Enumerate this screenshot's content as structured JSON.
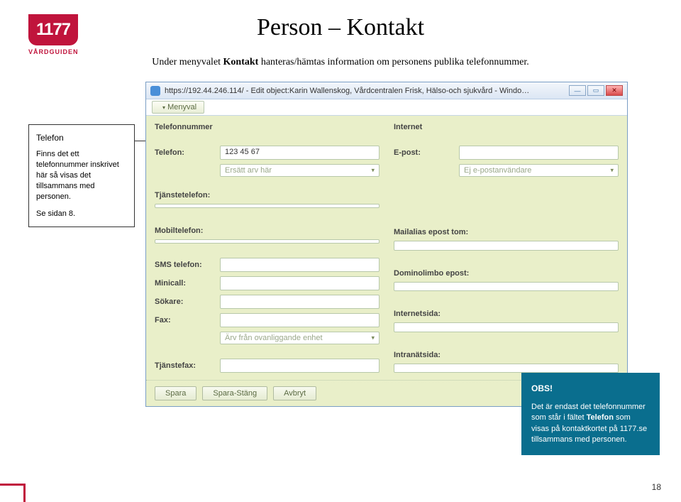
{
  "logo": {
    "text": "1177",
    "sub": "VÅRDGUIDEN"
  },
  "slide": {
    "title": "Person – Kontakt",
    "intro_prefix": "Under menyvalet ",
    "intro_bold": "Kontakt",
    "intro_suffix": " hanteras/hämtas information om personens publika telefonnummer."
  },
  "window": {
    "url_title": "https://192.44.246.114/ - Edit object:Karin Wallenskog, Vårdcentralen Frisk, Hälso-och sjukvård - Windows Internet Explorer",
    "menyval": "Menyval"
  },
  "left_col": {
    "section": "Telefonnummer",
    "telefon_label": "Telefon:",
    "telefon_value": "123 45 67",
    "ersatt_placeholder": "Ersätt arv här",
    "tjanstetelefon_label": "Tjänstetelefon:",
    "mobiltelefon_label": "Mobiltelefon:",
    "sms_label": "SMS telefon:",
    "minicall_label": "Minicall:",
    "sokare_label": "Sökare:",
    "fax_label": "Fax:",
    "arv_placeholder": "Ärv från ovanliggande enhet",
    "tjanstefax_label": "Tjänstefax:"
  },
  "right_col": {
    "section": "Internet",
    "epost_label": "E-post:",
    "ej_epost_placeholder": "Ej e-postanvändare",
    "mailalias_label": "Mailalias epost tom:",
    "dominolimbo_label": "Dominolimbo epost:",
    "internetsida_label": "Internetsida:",
    "intranatsida_label": "Intranätsida:"
  },
  "buttons": {
    "spara": "Spara",
    "spara_stang": "Spara-Stäng",
    "avbryt": "Avbryt"
  },
  "callout_left": {
    "title": "Telefon",
    "body": "Finns det ett telefonnummer inskrivet här så visas det tillsammans med personen.",
    "ref": "Se sidan 8."
  },
  "callout_right": {
    "obs": "OBS!",
    "text_prefix": "Det är endast det telefonnummer som står i fältet ",
    "bold": "Telefon",
    "text_suffix": " som visas på kontaktkortet på 1177.se tillsammans med personen."
  },
  "page_number": "18"
}
